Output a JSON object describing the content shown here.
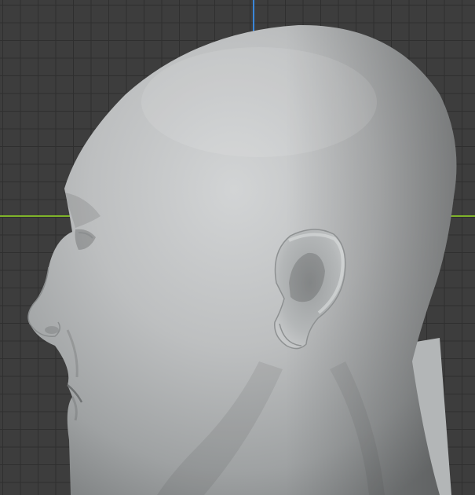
{
  "viewport": {
    "background": "#3d3d3d",
    "grid_line_color": "#2f2f2f",
    "x_axis_color": "#7fb32a",
    "y_axis_color": "#3a86d9"
  },
  "model": {
    "name": "sculpted-head-bust",
    "view": "side profile",
    "material_color": "#b9bcbd"
  }
}
